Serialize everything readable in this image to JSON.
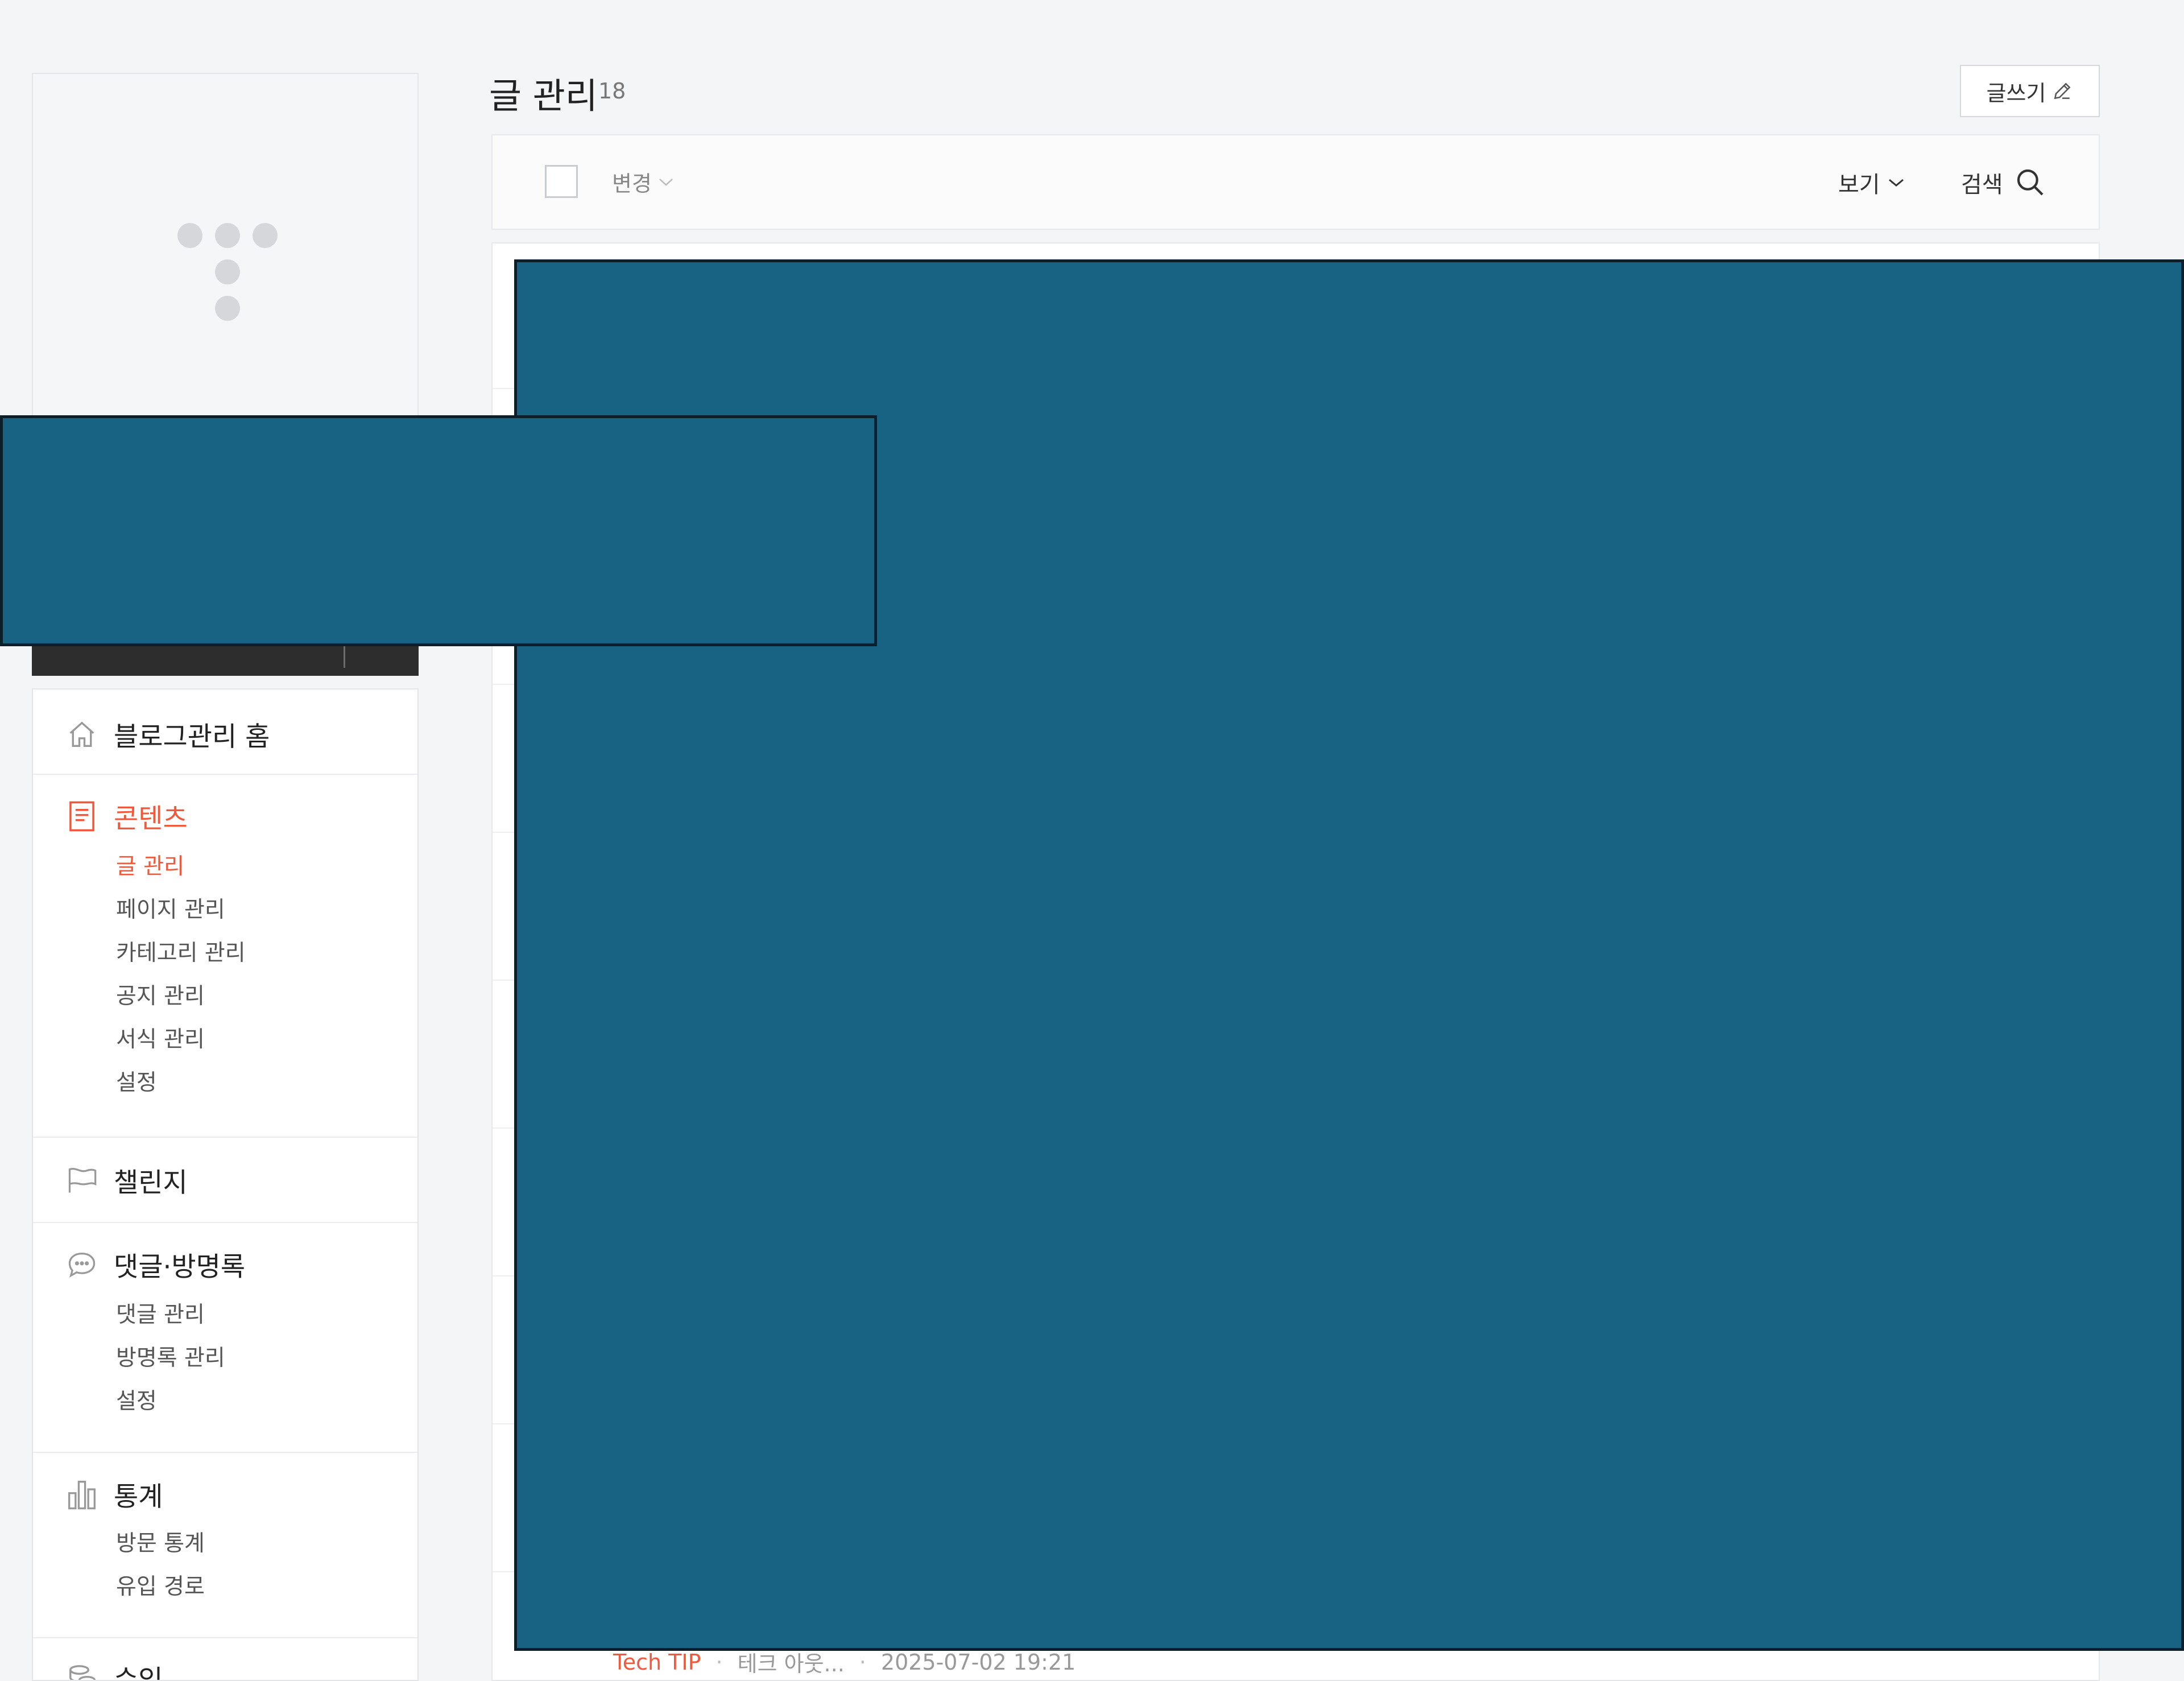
{
  "header": {
    "title": "글 관리",
    "count": "18",
    "write_button": "글쓰기"
  },
  "toolbar": {
    "change_label": "변경",
    "view_label": "보기",
    "search_label": "검색"
  },
  "sidebar": {
    "home_label": "블로그관리 홈",
    "contents": {
      "label": "콘텐츠",
      "items": [
        "글 관리",
        "페이지 관리",
        "카테고리 관리",
        "공지 관리",
        "서식 관리",
        "설정"
      ]
    },
    "challenge_label": "챌린지",
    "comments": {
      "label": "댓글·방명록",
      "items": [
        "댓글 관리",
        "방명록 관리",
        "설정"
      ]
    },
    "stats": {
      "label": "통계",
      "items": [
        "방문 통계",
        "유입 경로"
      ]
    },
    "revenue_label": "수익"
  },
  "post_row": {
    "category": "Tech TIP",
    "author": "테크 아웃...",
    "date": "2025-07-02 19:21"
  },
  "colors": {
    "accent": "#ef5a3d",
    "redaction": "#186284"
  }
}
